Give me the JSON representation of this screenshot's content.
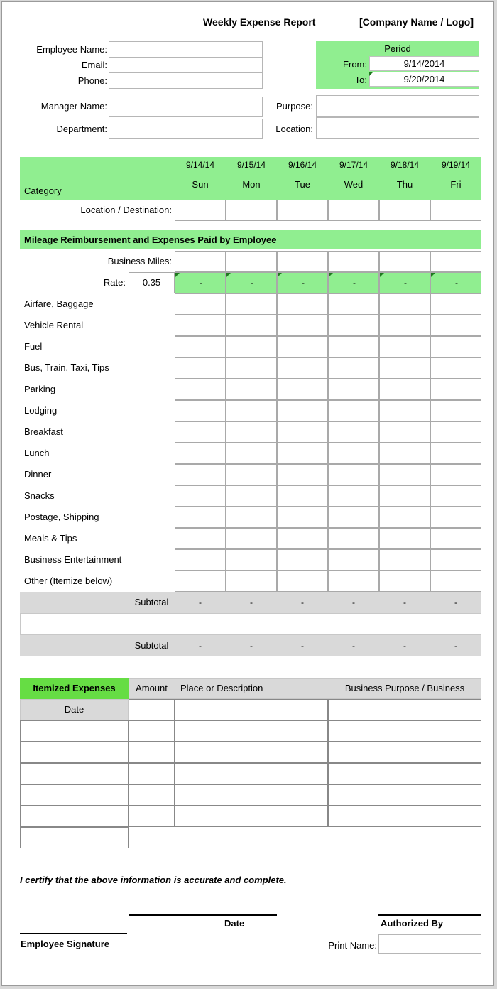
{
  "document": {
    "title": "Weekly Expense Report",
    "company_placeholder": "[Company Name / Logo]"
  },
  "employee_fields": [
    {
      "label": "Employee Name:",
      "value": ""
    },
    {
      "label": "Email:",
      "value": ""
    },
    {
      "label": "Phone:",
      "value": ""
    }
  ],
  "manager_fields": [
    {
      "label": "Manager Name:",
      "value": ""
    },
    {
      "label": "Department:",
      "value": ""
    }
  ],
  "trip_fields": [
    {
      "label": "Purpose:",
      "value": ""
    },
    {
      "label": "Location:",
      "value": ""
    }
  ],
  "period": {
    "header": "Period",
    "from_label": "From:",
    "from_value": "9/14/2014",
    "to_label": "To:",
    "to_value": "9/20/2014"
  },
  "expense_table": {
    "category_header": "Category",
    "days": [
      {
        "date": "9/14/14",
        "name": "Sun"
      },
      {
        "date": "9/15/14",
        "name": "Mon"
      },
      {
        "date": "9/16/14",
        "name": "Tue"
      },
      {
        "date": "9/17/14",
        "name": "Wed"
      },
      {
        "date": "9/18/14",
        "name": "Thu"
      },
      {
        "date": "9/19/14",
        "name": "Fri"
      }
    ],
    "location_row_label": "Location / Destination:",
    "mileage_band": "Mileage Reimbursement and Expenses Paid by Employee",
    "business_miles_label": "Business Miles:",
    "rate_label": "Rate:",
    "rate_value": "0.35",
    "rate_cells": [
      "-",
      "-",
      "-",
      "-",
      "-",
      "-"
    ],
    "categories": [
      "Airfare, Baggage",
      "Vehicle Rental",
      "Fuel",
      "Bus, Train, Taxi, Tips",
      "Parking",
      "Lodging",
      "Breakfast",
      "Lunch",
      "Dinner",
      "Snacks",
      "Postage, Shipping",
      "Meals & Tips",
      "Business Entertainment",
      "Other (Itemize below)"
    ],
    "subtotal_label": "Subtotal",
    "subtotal_1": [
      "-",
      "-",
      "-",
      "-",
      "-",
      "-"
    ],
    "subtotal_2": [
      "-",
      "-",
      "-",
      "-",
      "-",
      "-"
    ]
  },
  "itemized": {
    "title": "Itemized Expenses",
    "columns": [
      "Amount",
      "Place or Description",
      "Business Purpose / Business"
    ],
    "date_label": "Date",
    "row_count": 6
  },
  "footer": {
    "certification": "I certify that the above information is accurate and complete.",
    "date_label": "Date",
    "authorized_by_label": "Authorized By",
    "employee_signature_label": "Employee Signature",
    "print_name_label": "Print Name:",
    "print_name_value": ""
  },
  "colors": {
    "header_green": "#90ee90",
    "itemized_green": "#66dd44",
    "subtotal_gray": "#d9d9d9",
    "page_bg": "#ffffff"
  }
}
